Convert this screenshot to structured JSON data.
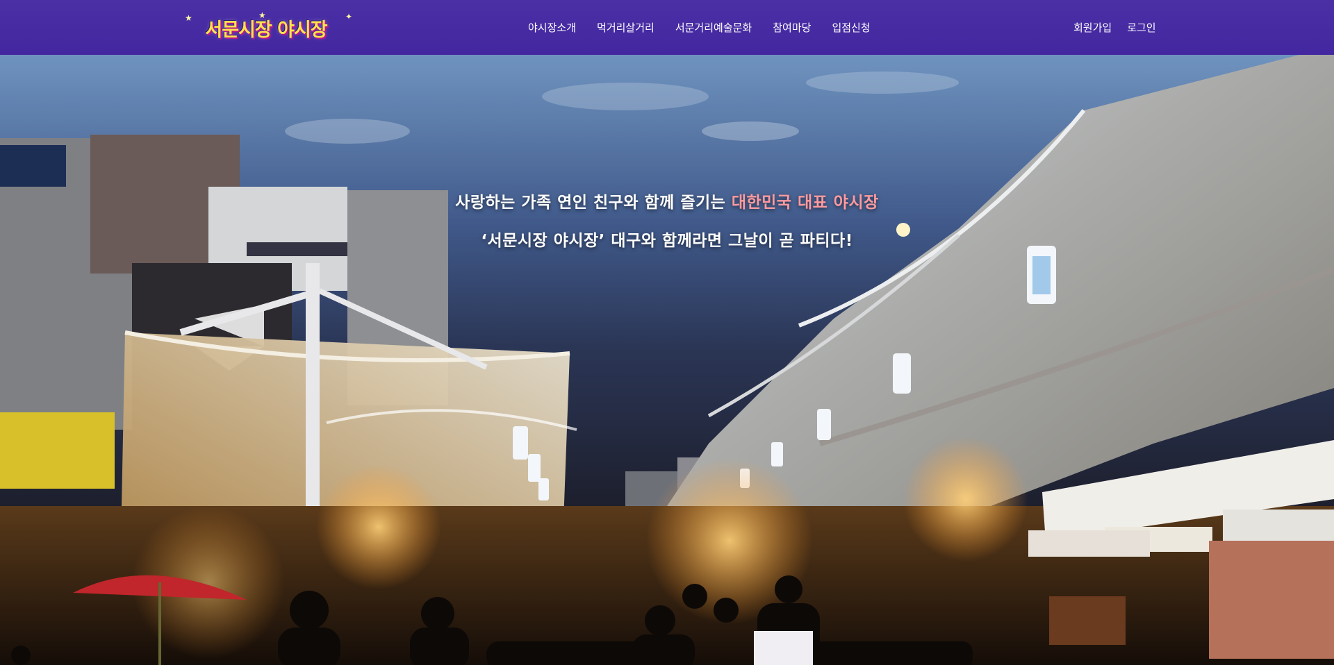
{
  "header": {
    "logo_text": "서문시장 야시장",
    "nav": [
      {
        "label": "야시장소개"
      },
      {
        "label": "먹거리살거리"
      },
      {
        "label": "서문거리예술문화"
      },
      {
        "label": "참여마당"
      },
      {
        "label": "입점신청"
      }
    ],
    "auth": {
      "signup": "회원가입",
      "login": "로그인"
    }
  },
  "hero": {
    "line1_prefix": "사랑하는 가족 연인 친구와 함께 즐기는 ",
    "line1_highlight": "대한민국 대표 야시장",
    "line2": "‘서문시장 야시장’ 대구와 함께라면 그날이 곧 파티다!"
  },
  "colors": {
    "header_bg": "#4a2fa5",
    "highlight": "#ff9a9f",
    "text": "#ffffff"
  }
}
